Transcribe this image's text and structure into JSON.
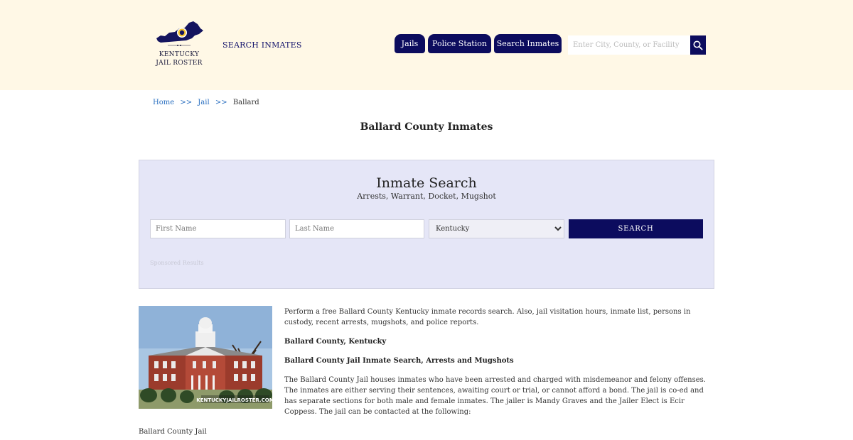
{
  "header": {
    "logo_line1": "Kentucky",
    "logo_line2": "Jail Roster",
    "top_link": "SEARCH INMATES",
    "nav": {
      "jails": "Jails",
      "police": "Police Station",
      "search": "Search Inmates"
    },
    "search_placeholder": "Enter City, County, or Facility"
  },
  "breadcrumb": {
    "home": "Home",
    "sep": ">>",
    "jail": "Jail",
    "current": "Ballard"
  },
  "page_title": "Ballard County Inmates",
  "panel": {
    "title": "Inmate Search",
    "subtitle": "Arrests, Warrant, Docket, Mugshot",
    "first_placeholder": "First Name",
    "last_placeholder": "Last Name",
    "state_selected": "Kentucky",
    "button": "SEARCH",
    "sponsored": "Sponsored Results"
  },
  "photo": {
    "watermark": "KENTUCKYJAILROSTER.COM"
  },
  "content": {
    "intro": "Perform a free Ballard County Kentucky inmate records search. Also, jail visitation hours, inmate list, persons in custody, recent arrests, mugshots, and police reports.",
    "heading1": "Ballard County, Kentucky",
    "heading2": "Ballard County Jail Inmate Search, Arrests and Mugshots",
    "body": "The Ballard County Jail houses inmates who have been arrested and charged with misdemeanor and felony offenses. The inmates are either serving their sentences, awaiting court or trial, or cannot afford a bond. The jail is co-ed and has separate sections for both male and female inmates. The jailer is Mandy Graves and the Jailer Elect is Ecir Coppess. The jail can be contacted at the following:",
    "footer": "Ballard County Jail"
  },
  "colors": {
    "navy": "#0c0c5e",
    "header_bg": "#fff8e6",
    "panel_bg": "#e5e6f7",
    "link": "#2a6fc0"
  }
}
